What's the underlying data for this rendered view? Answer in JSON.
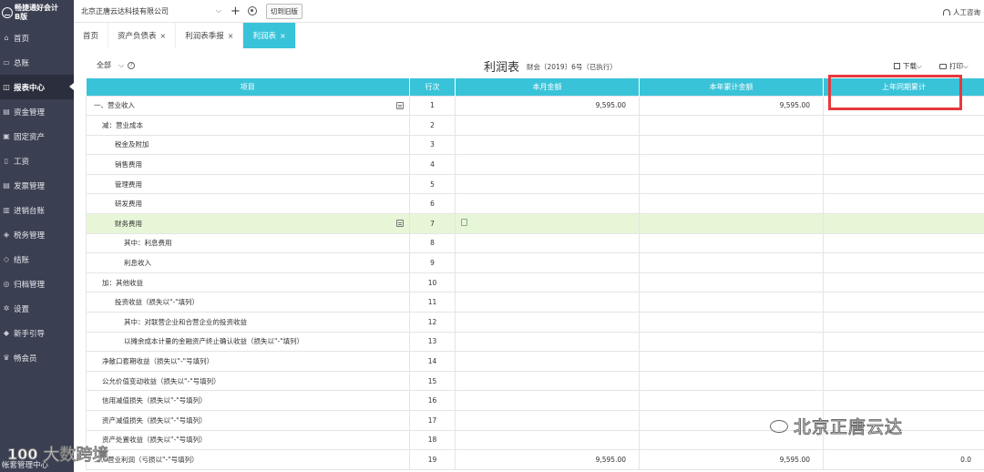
{
  "app": {
    "name_line1": "畅捷通好会计",
    "name_line2": "B版"
  },
  "sidebar": {
    "items": [
      {
        "label": "首页",
        "icon": "home-icon",
        "glyph": "⌂"
      },
      {
        "label": "总账",
        "icon": "ledger-icon",
        "glyph": "▭"
      },
      {
        "label": "报表中心",
        "icon": "report-icon",
        "glyph": "◫",
        "active": true
      },
      {
        "label": "资金管理",
        "icon": "fund-icon",
        "glyph": "▤"
      },
      {
        "label": "固定资产",
        "icon": "asset-icon",
        "glyph": "▣"
      },
      {
        "label": "工资",
        "icon": "salary-icon",
        "glyph": "▯"
      },
      {
        "label": "发票管理",
        "icon": "invoice-icon",
        "glyph": "▤"
      },
      {
        "label": "进销台账",
        "icon": "inventory-icon",
        "glyph": "▥"
      },
      {
        "label": "税务管理",
        "icon": "tax-icon",
        "glyph": "◈"
      },
      {
        "label": "结账",
        "icon": "close-account-icon",
        "glyph": "◇"
      },
      {
        "label": "归档管理",
        "icon": "archive-icon",
        "glyph": "◎"
      },
      {
        "label": "设置",
        "icon": "settings-icon",
        "glyph": "✲"
      },
      {
        "label": "新手引导",
        "icon": "guide-icon",
        "glyph": "◆"
      },
      {
        "label": "畅会员",
        "icon": "member-icon",
        "glyph": "♛"
      }
    ],
    "footer": "帐套管理中心"
  },
  "topbar": {
    "company": "北京正唐云达科技有限公司",
    "switch_label": "切到旧版",
    "support_label": "人工咨询"
  },
  "tabs": [
    {
      "label": "首页",
      "closable": false
    },
    {
      "label": "资产负债表",
      "closable": true
    },
    {
      "label": "利润表季报",
      "closable": true
    },
    {
      "label": "利润表",
      "closable": true,
      "active": true
    }
  ],
  "report": {
    "scope": "全部",
    "title": "利润表",
    "subtitle": "财会〔2019〕6号（已执行）",
    "download_label": "下载",
    "print_label": "打印"
  },
  "table": {
    "columns": [
      "项目",
      "行次",
      "本月金额",
      "本年累计金额",
      "上年同期累计"
    ],
    "rows": [
      {
        "item": "一、营业收入",
        "line": "1",
        "month": "9,595.00",
        "ytd": "9,595.00",
        "prev": "",
        "indent": 0,
        "edit": true
      },
      {
        "item": "减：营业成本",
        "line": "2",
        "month": "",
        "ytd": "",
        "prev": "",
        "indent": 1
      },
      {
        "item": "税金及附加",
        "line": "3",
        "month": "",
        "ytd": "",
        "prev": "",
        "indent": 2
      },
      {
        "item": "销售费用",
        "line": "4",
        "month": "",
        "ytd": "",
        "prev": "",
        "indent": 2
      },
      {
        "item": "管理费用",
        "line": "5",
        "month": "",
        "ytd": "",
        "prev": "",
        "indent": 2
      },
      {
        "item": "研发费用",
        "line": "6",
        "month": "",
        "ytd": "",
        "prev": "",
        "indent": 2
      },
      {
        "item": "财务费用",
        "line": "7",
        "month": "",
        "ytd": "",
        "prev": "",
        "indent": 2,
        "edit": true,
        "highlight": true,
        "note": true
      },
      {
        "item": "其中：利息费用",
        "line": "8",
        "month": "",
        "ytd": "",
        "prev": "",
        "indent": 3
      },
      {
        "item": "利息收入",
        "line": "9",
        "month": "",
        "ytd": "",
        "prev": "",
        "indent": 3
      },
      {
        "item": "加：其他收益",
        "line": "10",
        "month": "",
        "ytd": "",
        "prev": "",
        "indent": 1
      },
      {
        "item": "投资收益（损失以\"-\"填列）",
        "line": "11",
        "month": "",
        "ytd": "",
        "prev": "",
        "indent": 2
      },
      {
        "item": "其中：对联营企业和合营企业的投资收益",
        "line": "12",
        "month": "",
        "ytd": "",
        "prev": "",
        "indent": 3
      },
      {
        "item": "以摊余成本计量的金融资产终止确认收益（损失以\"-\"填列）",
        "line": "13",
        "month": "",
        "ytd": "",
        "prev": "",
        "indent": 3
      },
      {
        "item": "净敞口套期收益（损失以\"-\"号填列）",
        "line": "14",
        "month": "",
        "ytd": "",
        "prev": "",
        "indent": 1
      },
      {
        "item": "公允价值变动收益（损失以\"-\"号填列）",
        "line": "15",
        "month": "",
        "ytd": "",
        "prev": "",
        "indent": 1
      },
      {
        "item": "信用减值损失（损失以\"-\"号填列）",
        "line": "16",
        "month": "",
        "ytd": "",
        "prev": "",
        "indent": 1
      },
      {
        "item": "资产减值损失（损失以\"-\"号填列）",
        "line": "17",
        "month": "",
        "ytd": "",
        "prev": "",
        "indent": 1
      },
      {
        "item": "资产处置收益（损失以\"-\"号填列）",
        "line": "18",
        "month": "",
        "ytd": "",
        "prev": "",
        "indent": 1
      },
      {
        "item": "二、营业利润（亏损以\"-\"号填列）",
        "line": "19",
        "month": "9,595.00",
        "ytd": "9,595.00",
        "prev": "0.0",
        "indent": 0
      }
    ]
  },
  "watermarks": {
    "wechat": "北京正唐云达",
    "brand_logo": "100",
    "brand_text": "大数跨境"
  },
  "colors": {
    "accent": "#39c3d9",
    "sidebar_bg": "#3a3f51",
    "highlight_row": "#e8f6d8",
    "annotation_red": "#e8383d"
  }
}
